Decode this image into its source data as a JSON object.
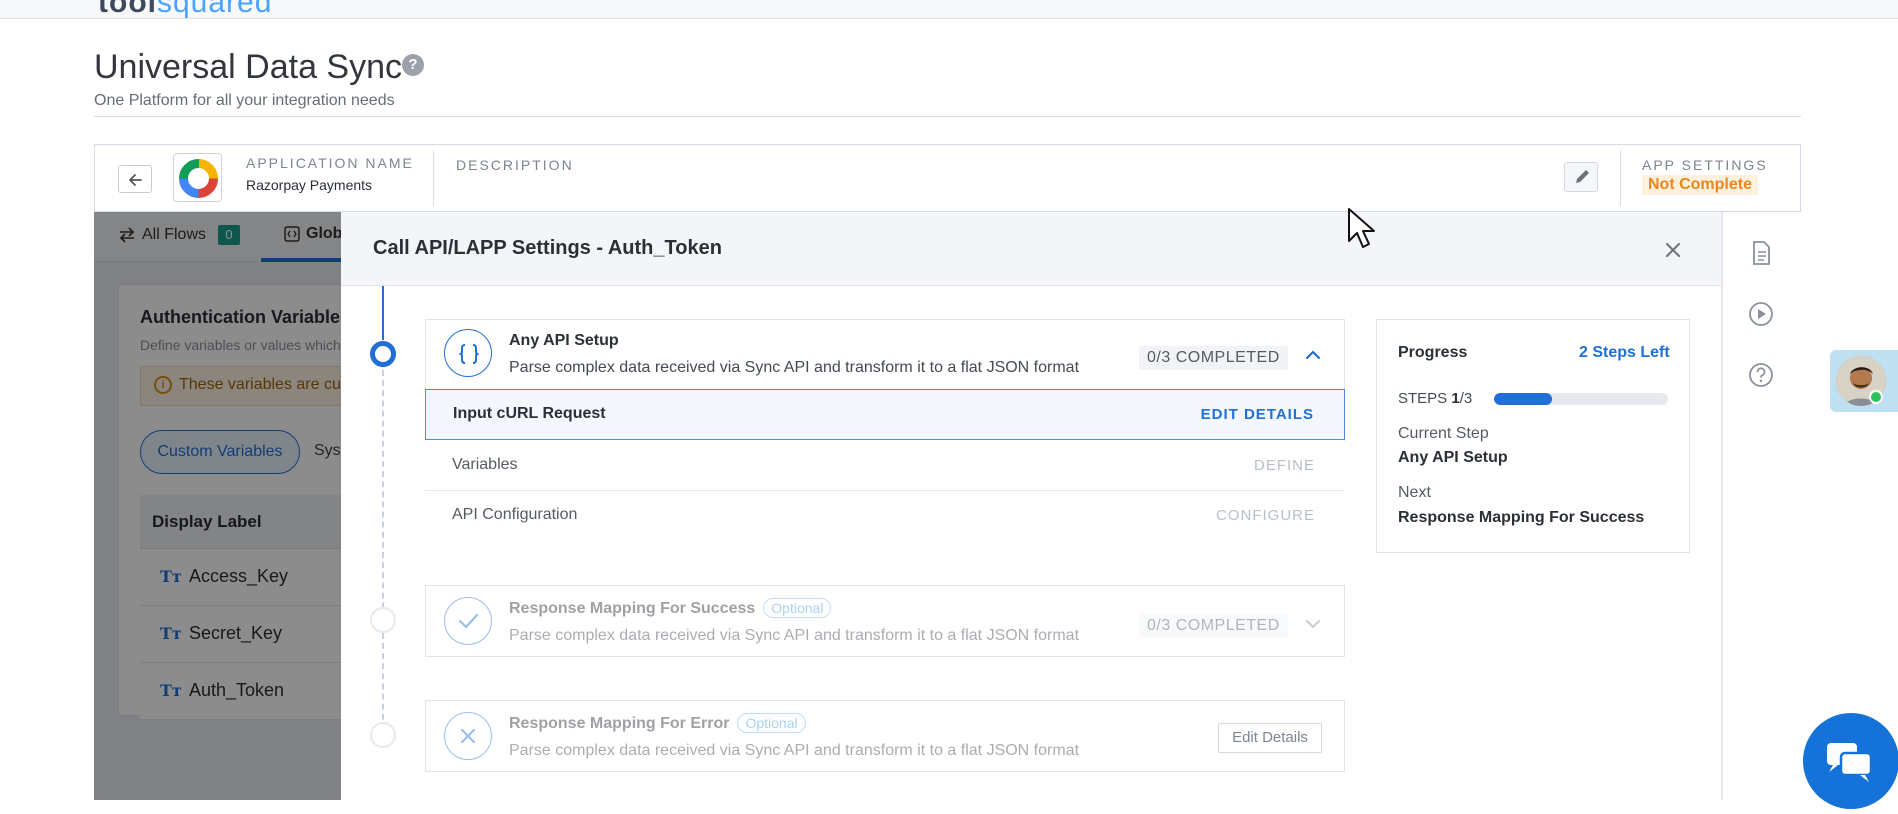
{
  "topbar": {
    "logo_prefix": "tool",
    "logo_highlight": "squared"
  },
  "header": {
    "title": "Universal Data Sync",
    "help_glyph": "?",
    "subtitle": "One Platform for all your integration needs"
  },
  "app_bar": {
    "app_name_label": "APPLICATION NAME",
    "app_name_value": "Razorpay Payments",
    "description_label": "DESCRIPTION",
    "app_settings_label": "APP SETTINGS",
    "app_settings_status": "Not Complete"
  },
  "background": {
    "tab_all_flows": "All Flows",
    "all_flows_count": "0",
    "tab_global": "Glob",
    "auth_title": "Authentication Variables",
    "auth_subtitle": "Define variables or values which",
    "warning_text": "These variables are cur",
    "pill_custom": "Custom Variables",
    "pill_system": "Syst",
    "table_header": "Display Label",
    "rows": [
      "Access_Key",
      "Secret_Key",
      "Auth_Token"
    ],
    "row_type_glyph": "Tт"
  },
  "modal": {
    "title": "Call API/LAPP Settings - Auth_Token",
    "steps": [
      {
        "title": "Any API Setup",
        "desc": "Parse complex data received via Sync API and transform it to a flat JSON format",
        "completed": "0/3 COMPLETED",
        "icon": "braces-icon",
        "sub_rows": [
          {
            "label": "Input cURL Request",
            "action": "EDIT DETAILS"
          },
          {
            "label": "Variables",
            "action": "DEFINE"
          },
          {
            "label": "API Configuration",
            "action": "CONFIGURE"
          }
        ]
      },
      {
        "title": "Response Mapping For Success",
        "optional": "Optional",
        "desc": "Parse complex data received via Sync API and transform it to a flat JSON format",
        "completed": "0/3 COMPLETED",
        "icon": "check-icon"
      },
      {
        "title": "Response Mapping For Error",
        "optional": "Optional",
        "desc": "Parse complex data received via Sync API and transform it to a flat JSON format",
        "action": "Edit Details",
        "icon": "x-icon"
      }
    ]
  },
  "progress": {
    "title": "Progress",
    "steps_left": "2 Steps Left",
    "steps_label": "STEPS",
    "steps_current": "1",
    "steps_total": "/3",
    "fraction_complete": 0.333,
    "current_step_label": "Current Step",
    "current_step_value": "Any API Setup",
    "next_label": "Next",
    "next_value": "Response Mapping For Success"
  },
  "colors": {
    "accent": "#1f6fd6",
    "warning": "#e8871e",
    "badge": "#1a9e8a",
    "chat": "#1572d8"
  }
}
